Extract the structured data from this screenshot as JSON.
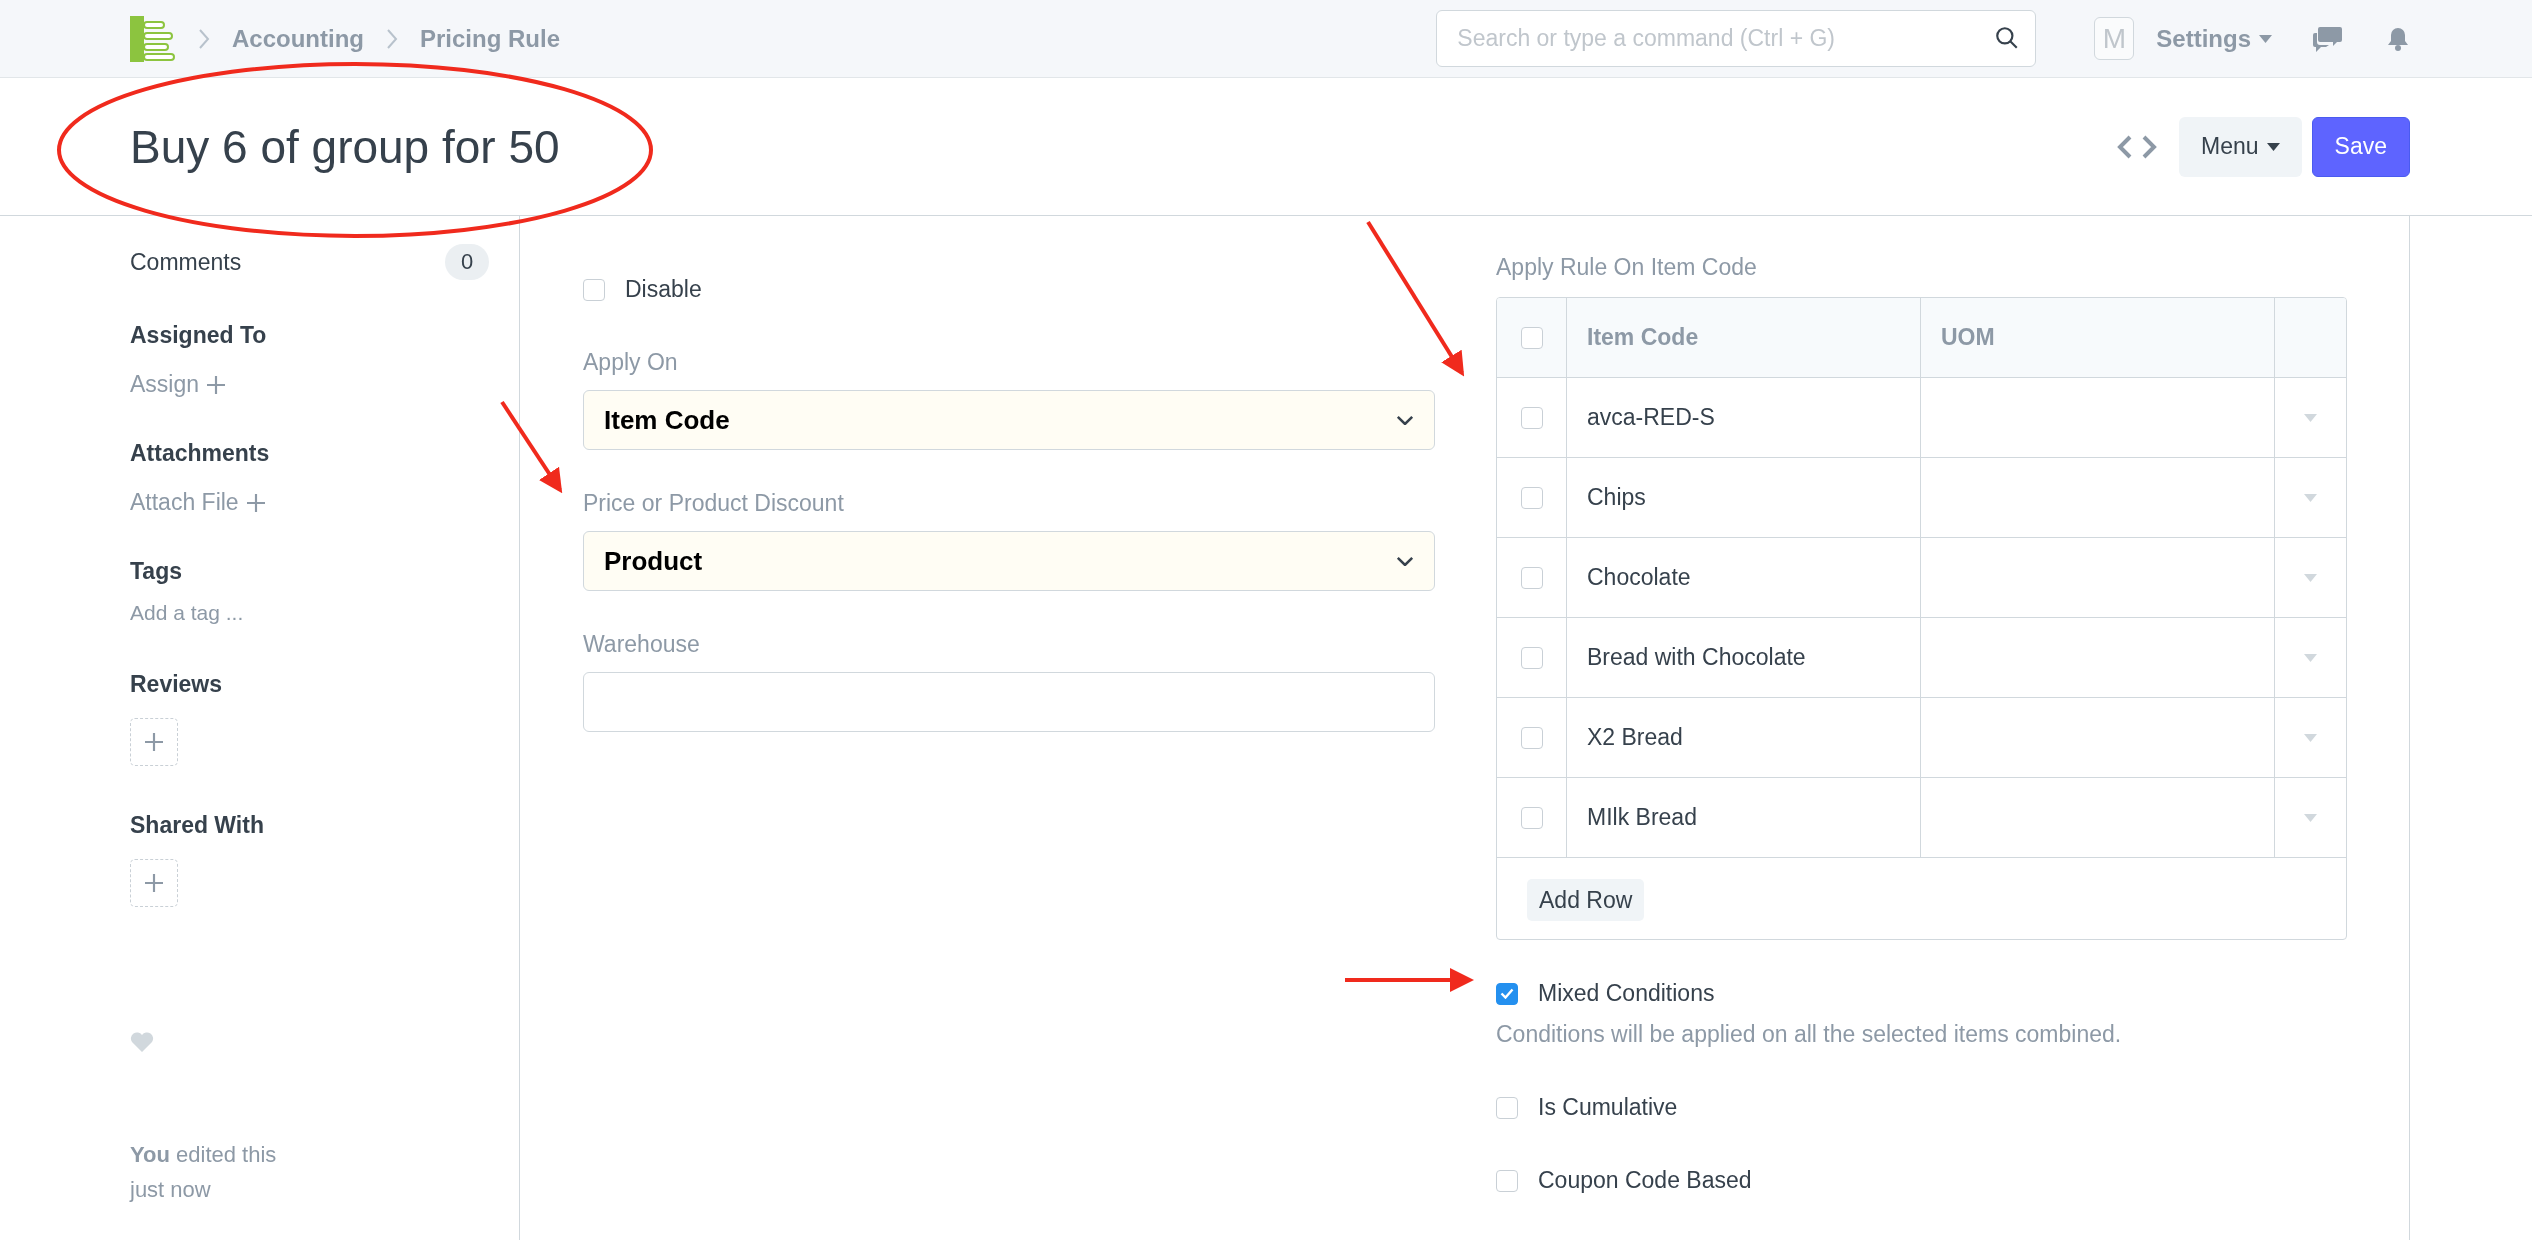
{
  "navbar": {
    "breadcrumbs": [
      "Accounting",
      "Pricing Rule"
    ],
    "search": {
      "placeholder": "Search or type a command (Ctrl + G)"
    },
    "avatar": "M",
    "settings": "Settings"
  },
  "header": {
    "title": "Buy 6 of group for 50",
    "menu": "Menu",
    "save": "Save"
  },
  "sidebar": {
    "comments": {
      "label": "Comments",
      "count": "0"
    },
    "sections": [
      {
        "kind": "link",
        "title": "Assigned To",
        "action": "Assign"
      },
      {
        "kind": "link",
        "title": "Attachments",
        "action": "Attach File"
      },
      {
        "kind": "tags",
        "title": "Tags",
        "action": "Add a tag ..."
      },
      {
        "kind": "add",
        "title": "Reviews"
      },
      {
        "kind": "add",
        "title": "Shared With"
      }
    ],
    "activity": "**You** edited this just now"
  },
  "form": {
    "disable": {
      "label": "Disable",
      "checked": false
    },
    "fields": [
      {
        "kind": "select",
        "label": "Apply On",
        "value": "Item Code"
      },
      {
        "kind": "select",
        "label": "Price or Product Discount",
        "value": "Product"
      },
      {
        "kind": "input",
        "label": "Warehouse"
      }
    ]
  },
  "table": {
    "label": "Apply Rule On Item Code",
    "select_all": {
      "checked": false
    },
    "columns": [
      "Item Code",
      "UOM"
    ],
    "rows": [
      {
        "item_code": "avca-RED-S",
        "checked": false
      },
      {
        "item_code": "Chips",
        "checked": false
      },
      {
        "item_code": "Chocolate",
        "checked": false
      },
      {
        "item_code": "Bread with Chocolate",
        "checked": false
      },
      {
        "item_code": "X2 Bread",
        "checked": false
      },
      {
        "item_code": "MIlk Bread",
        "checked": false
      }
    ],
    "add_row": "Add Row"
  },
  "options": [
    {
      "label": "Mixed Conditions",
      "checked": true,
      "description": "Conditions will be applied on all the selected items combined."
    },
    {
      "label": "Is Cumulative",
      "checked": false
    },
    {
      "label": "Coupon Code Based",
      "checked": false
    }
  ]
}
